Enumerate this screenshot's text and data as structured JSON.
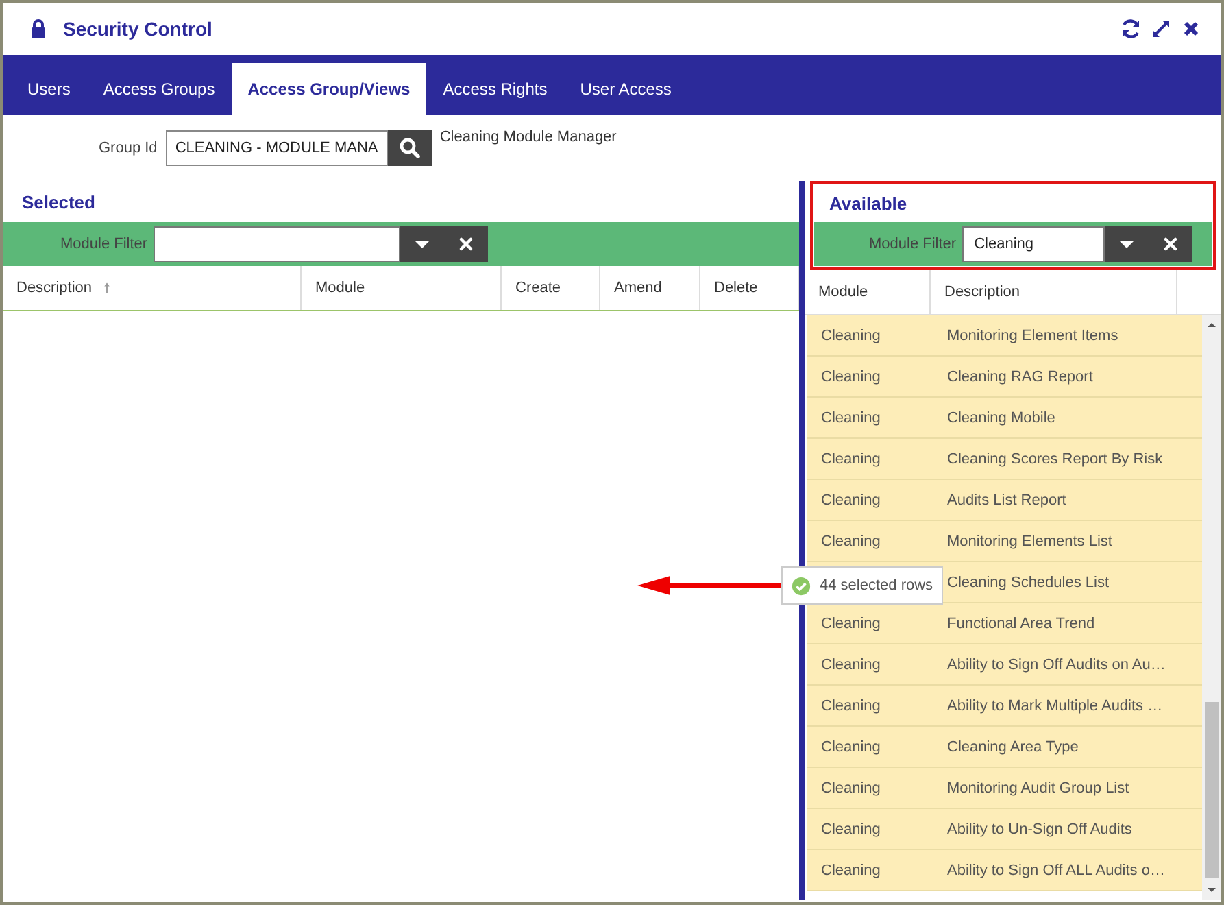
{
  "window": {
    "title": "Security Control"
  },
  "tabs": [
    {
      "label": "Users",
      "selected": false
    },
    {
      "label": "Access Groups",
      "selected": false
    },
    {
      "label": "Access Group/Views",
      "selected": true
    },
    {
      "label": "Access Rights",
      "selected": false
    },
    {
      "label": "User Access",
      "selected": false
    }
  ],
  "group": {
    "label": "Group Id",
    "value": "CLEANING - MODULE MANA",
    "description": "Cleaning Module Manager"
  },
  "selected_panel": {
    "title": "Selected",
    "filter": {
      "label": "Module Filter"
    },
    "columns": [
      {
        "label": "Description",
        "sorted": true
      },
      {
        "label": "Module",
        "sorted": false
      },
      {
        "label": "Create",
        "sorted": false
      },
      {
        "label": "Amend",
        "sorted": false
      },
      {
        "label": "Delete",
        "sorted": false
      }
    ]
  },
  "available_panel": {
    "title": "Available",
    "filter": {
      "label": "Module Filter",
      "value": "Cleaning"
    },
    "columns": [
      {
        "label": "Module"
      },
      {
        "label": "Description"
      }
    ],
    "rows": [
      {
        "module": "Cleaning",
        "description": "Monitoring Element Items",
        "selected": true
      },
      {
        "module": "Cleaning",
        "description": "Cleaning RAG Report",
        "selected": true
      },
      {
        "module": "Cleaning",
        "description": "Cleaning Mobile",
        "selected": true
      },
      {
        "module": "Cleaning",
        "description": "Cleaning Scores Report By Risk",
        "selected": true
      },
      {
        "module": "Cleaning",
        "description": "Audits List Report",
        "selected": true
      },
      {
        "module": "Cleaning",
        "description": "Monitoring Elements List",
        "selected": true
      },
      {
        "description": "Cleaning Schedules List",
        "selected": true
      },
      {
        "module": "Cleaning",
        "description": "Functional Area Trend",
        "selected": true
      },
      {
        "module": "Cleaning",
        "description": "Ability to Sign Off Audits on Au…",
        "selected": true
      },
      {
        "module": "Cleaning",
        "description": "Ability to Mark Multiple Audits …",
        "selected": true
      },
      {
        "module": "Cleaning",
        "description": "Cleaning Area Type",
        "selected": true
      },
      {
        "module": "Cleaning",
        "description": "Monitoring Audit Group List",
        "selected": true
      },
      {
        "module": "Cleaning",
        "description": "Ability to Un-Sign Off Audits",
        "selected": true
      },
      {
        "module": "Cleaning",
        "description": "Ability to Sign Off ALL Audits o…",
        "selected": true
      }
    ]
  },
  "status_tooltip": {
    "text": "44 selected rows"
  }
}
